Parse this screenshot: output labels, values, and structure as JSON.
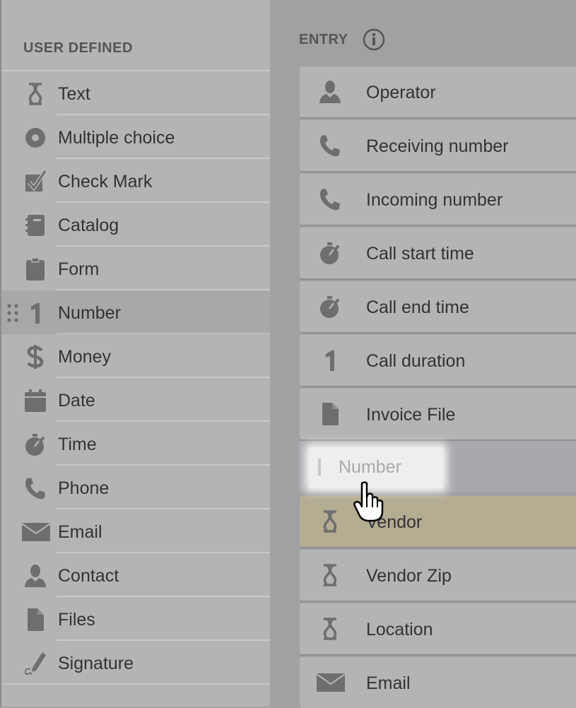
{
  "left_panel": {
    "title": "USER DEFINED",
    "items": [
      {
        "label": "Text",
        "icon": "text-field-icon"
      },
      {
        "label": "Multiple choice",
        "icon": "radio-icon"
      },
      {
        "label": "Check Mark",
        "icon": "checkbox-icon"
      },
      {
        "label": "Catalog",
        "icon": "catalog-icon"
      },
      {
        "label": "Form",
        "icon": "clipboard-icon"
      },
      {
        "label": "Number",
        "icon": "number-icon"
      },
      {
        "label": "Money",
        "icon": "dollar-icon"
      },
      {
        "label": "Date",
        "icon": "calendar-icon"
      },
      {
        "label": "Time",
        "icon": "stopwatch-icon"
      },
      {
        "label": "Phone",
        "icon": "phone-icon"
      },
      {
        "label": "Email",
        "icon": "envelope-icon"
      },
      {
        "label": "Contact",
        "icon": "person-icon"
      },
      {
        "label": "Files",
        "icon": "file-icon"
      },
      {
        "label": "Signature",
        "icon": "signature-icon"
      }
    ]
  },
  "right_panel": {
    "title": "ENTRY",
    "entries": [
      {
        "label": "Operator",
        "icon": "person-icon"
      },
      {
        "label": "Receiving number",
        "icon": "phone-icon"
      },
      {
        "label": "Incoming number",
        "icon": "phone-icon"
      },
      {
        "label": "Call start time",
        "icon": "stopwatch-icon"
      },
      {
        "label": "Call end time",
        "icon": "stopwatch-icon"
      },
      {
        "label": "Call duration",
        "icon": "number-icon"
      },
      {
        "label": "Invoice File",
        "icon": "file-icon"
      },
      {
        "label": "Vendor",
        "icon": "text-field-icon"
      },
      {
        "label": "Vendor Zip",
        "icon": "text-field-icon"
      },
      {
        "label": "Location",
        "icon": "text-field-icon"
      },
      {
        "label": "Email",
        "icon": "envelope-icon"
      }
    ]
  },
  "drag": {
    "ghost_label": "Number"
  },
  "colors": {
    "panel_left": "#b4b4b4",
    "panel_right": "#a1a1a4",
    "highlight_drop": "#b4ad92",
    "icon": "#6e6e6e"
  }
}
